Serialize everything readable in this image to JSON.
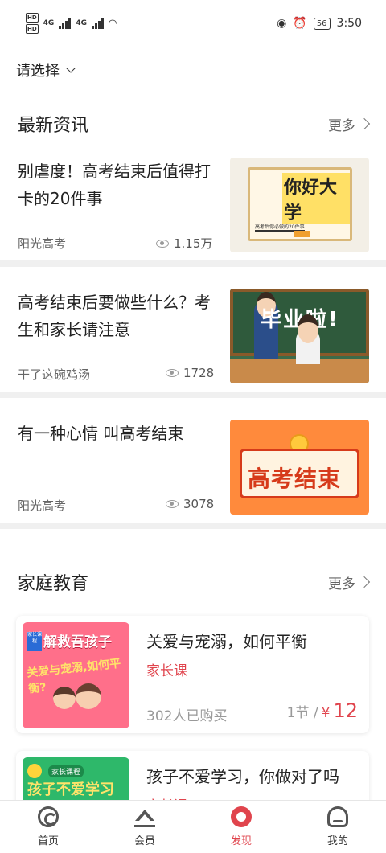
{
  "status_bar": {
    "hd1": "HD",
    "hd2": "HD",
    "net1": "4G",
    "net2": "4G",
    "battery": "56",
    "time": "3:50"
  },
  "selector": {
    "label": "请选择"
  },
  "news_section": {
    "title": "最新资讯",
    "more": "更多",
    "items": [
      {
        "title": "别虐度！高考结束后值得打卡的20件事",
        "source": "阳光高考",
        "views": "1.15万",
        "thumb_text": "你好大学",
        "thumb_caption": "高考后你必做的20件事"
      },
      {
        "title": "高考结束后要做些什么？考生和家长请注意",
        "source": "干了这碗鸡汤",
        "views": "1728",
        "thumb_text": "毕业啦!"
      },
      {
        "title": "有一种心情 叫高考结束",
        "source": "阳光高考",
        "views": "3078",
        "thumb_text": "高考结束"
      }
    ]
  },
  "family_section": {
    "title": "家庭教育",
    "more": "更多",
    "courses": [
      {
        "title": "关爱与宠溺，如何平衡",
        "category": "家长课",
        "buyers": "302人已购买",
        "lessons": "1节 /",
        "currency": "¥",
        "price": "12",
        "thumb_tag": "家长课程",
        "thumb_head": "解救吾孩子",
        "thumb_sub": "关爱与宠溺,如何平衡?"
      },
      {
        "title": "孩子不爱学习，你做对了吗",
        "category": "家长课",
        "thumb_tag": "家长课程",
        "thumb_head": "孩子不爱学习"
      }
    ]
  },
  "bottom_nav": {
    "items": [
      {
        "label": "首页",
        "icon": "home-icon"
      },
      {
        "label": "会员",
        "icon": "crown-icon"
      },
      {
        "label": "发现",
        "icon": "discover-icon",
        "active": true
      },
      {
        "label": "我的",
        "icon": "profile-icon"
      }
    ]
  },
  "colors": {
    "accent": "#e0444d",
    "divider": "#f0f0f0"
  }
}
